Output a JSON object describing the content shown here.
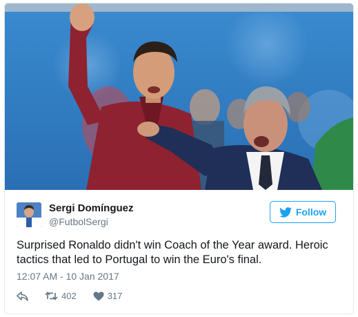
{
  "photo": {
    "subject": "football-sideline-photo",
    "colors": {
      "sky_blue": "#2f7fc4",
      "jersey_red": "#8e2230",
      "suit_navy": "#1f2f57"
    }
  },
  "author": {
    "name": "Sergi Domínguez",
    "handle": "@FutbolSergi"
  },
  "follow_button": {
    "label": "Follow",
    "icon": "twitter-bird-icon"
  },
  "tweet": {
    "text": "Surprised Ronaldo didn't win Coach of the Year award. Heroic tactics that led to Portugal to win the Euro's final.",
    "timestamp": "12:07 AM - 10 Jan 2017"
  },
  "actions": {
    "reply_icon": "reply-icon",
    "retweet_icon": "retweet-icon",
    "retweet_count": "402",
    "like_icon": "heart-icon",
    "like_count": "317"
  },
  "theme": {
    "accent": "#1da1f2",
    "muted": "#657786",
    "text": "#14171a",
    "border": "#e1e8ed"
  }
}
